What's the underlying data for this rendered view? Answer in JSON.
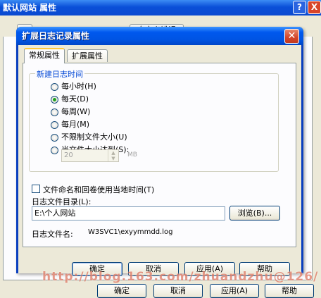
{
  "background_window": {
    "title": "默认网站  属性",
    "help_glyph": "?",
    "close_glyph": "X",
    "tabs": [
      "",
      "自定义错误"
    ],
    "buttons": {
      "ok": "确定",
      "cancel": "取消",
      "apply": "应用(A)",
      "help": "帮助"
    }
  },
  "dialog": {
    "title": "扩展日志记录属性",
    "close_glyph": "✕",
    "tabs": [
      {
        "label": "常规属性",
        "active": true
      },
      {
        "label": "扩展属性",
        "active": false
      }
    ],
    "group": {
      "label": "新建日志时间",
      "options": [
        {
          "label": "每小时(H)",
          "checked": false
        },
        {
          "label": "每天(D)",
          "checked": true
        },
        {
          "label": "每周(W)",
          "checked": false
        },
        {
          "label": "每月(M)",
          "checked": false
        },
        {
          "label": "不限制文件大小(U)",
          "checked": false
        },
        {
          "label": "当文件大小达到(S):",
          "checked": false
        }
      ],
      "size_value": "20",
      "size_unit": "MB"
    },
    "local_time_checkbox": {
      "label": "文件命名和回卷使用当地时间(T)",
      "checked": false
    },
    "log_dir": {
      "label": "日志文件目录(L):",
      "value": "E:\\个人网站",
      "browse_label": "浏览(B)..."
    },
    "log_file": {
      "label": "日志文件名:",
      "value": "W3SVC1\\exyymmdd.log"
    },
    "buttons": {
      "ok": "确定",
      "cancel": "取消",
      "apply": "应用(A)",
      "help": "帮助"
    }
  },
  "watermark": "http://blog.163.com/zhuandzhu@126/",
  "colors": {
    "titlebar": "#0054e3",
    "group_label": "#0046d5",
    "face": "#ece9d8",
    "radio_dot": "#21a121"
  }
}
